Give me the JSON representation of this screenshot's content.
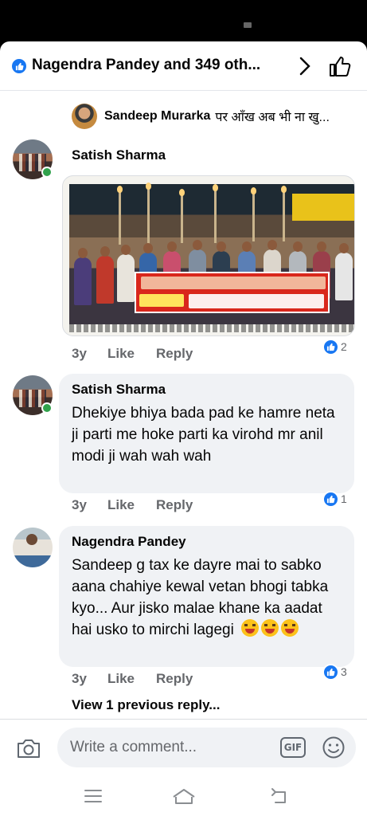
{
  "header": {
    "reactions_title": "Nagendra Pandey and 349 oth..."
  },
  "reply_preview": {
    "name": "Sandeep Murarka",
    "text": "पर आँख अब भी ना खु..."
  },
  "comments": [
    {
      "author": "Satish Sharma",
      "has_photo": true,
      "age": "3y",
      "like_label": "Like",
      "reply_label": "Reply",
      "reaction_count": "2"
    },
    {
      "author": "Satish Sharma",
      "text": "Dhekiye  bhiya bada  pad ke hamre neta ji parti me hoke parti ka virohd  mr anil modi ji wah wah wah",
      "age": "3y",
      "like_label": "Like",
      "reply_label": "Reply",
      "reaction_count": "1"
    },
    {
      "author": "Nagendra Pandey",
      "text": "Sandeep g tax ke dayre mai to sabko aana chahiye kewal vetan bhogi tabka kyo... Aur jisko malae khane ka aadat hai usko to mirchi lagegi",
      "emoji": [
        "squinting-tongue-emoji",
        "squinting-tongue-emoji",
        "squinting-tongue-emoji"
      ],
      "age": "3y",
      "like_label": "Like",
      "reply_label": "Reply",
      "reaction_count": "3"
    }
  ],
  "view_previous": "View 1 previous reply...",
  "composer": {
    "placeholder": "Write a comment...",
    "gif_label": "GIF"
  },
  "colors": {
    "facebook_blue": "#1877f2",
    "online_green": "#31a24c",
    "bubble_gray": "#f0f2f5",
    "meta_gray": "#65676b"
  }
}
